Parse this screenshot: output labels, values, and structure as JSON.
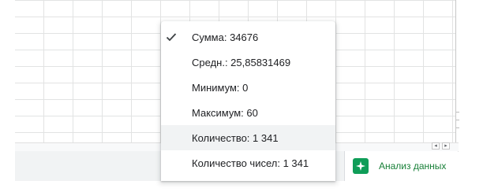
{
  "menu": {
    "items": [
      {
        "label": "Сумма: 34676",
        "checked": true
      },
      {
        "label": "Средн.: 25,85831469",
        "checked": false
      },
      {
        "label": "Минимум: 0",
        "checked": false
      },
      {
        "label": "Максимум: 60",
        "checked": false
      },
      {
        "label": "Количество: 1 341",
        "checked": false,
        "highlighted": true
      },
      {
        "label": "Количество чисел: 1 341",
        "checked": false
      }
    ]
  },
  "explore": {
    "label": "Анализ данных",
    "icon": "explore-sparkle-icon",
    "color": "#0f9d58"
  },
  "scrollbar": {
    "left_icon": "◂",
    "right_icon": "▸"
  }
}
